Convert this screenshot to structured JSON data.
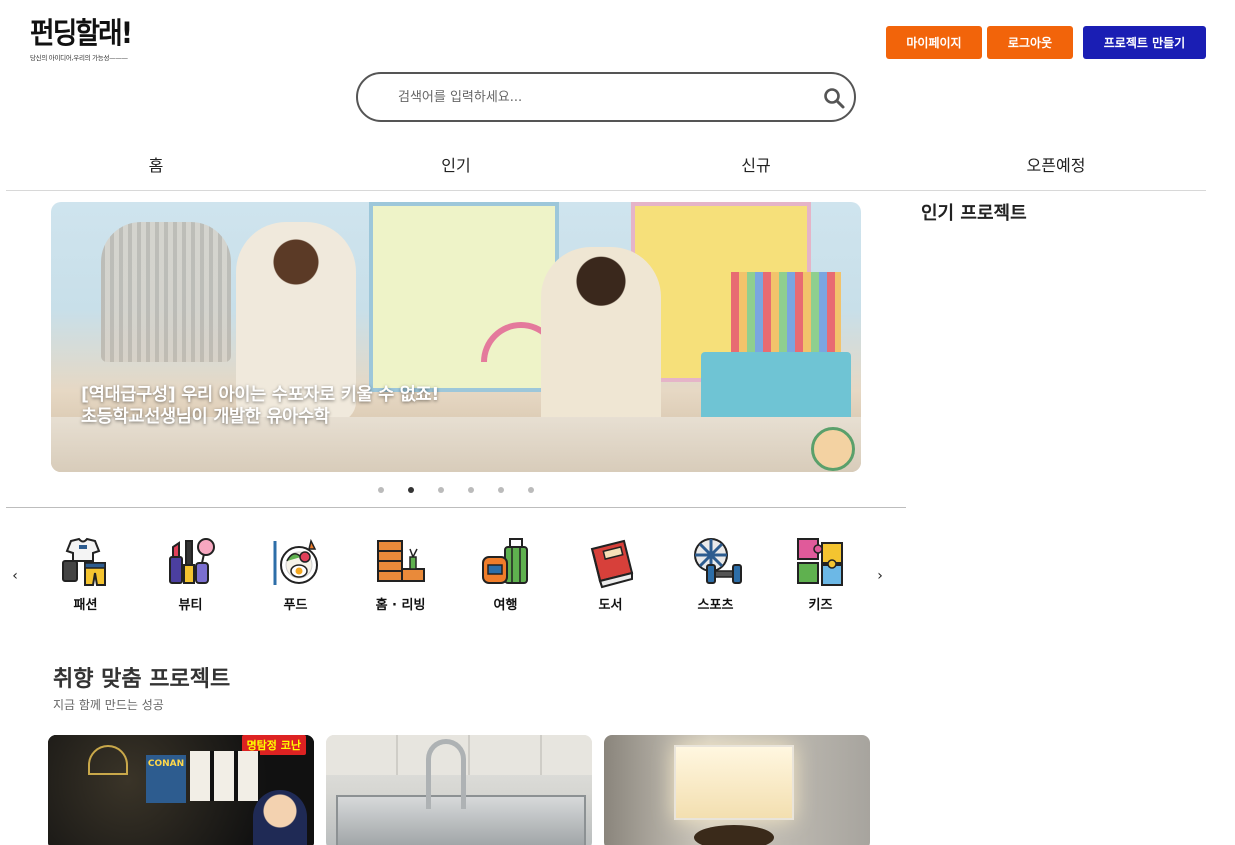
{
  "brand": {
    "logo_title": "펀딩할래!",
    "logo_subtitle": "당신의 아이디어,우리의 가능성———"
  },
  "header": {
    "mypage_label": "마이페이지",
    "logout_label": "로그아웃",
    "create_label": "프로젝트 만들기",
    "colors": {
      "orange": "#f2640a",
      "blue": "#1a1eb4"
    }
  },
  "search": {
    "placeholder": "검색어를 입력하세요..."
  },
  "nav": {
    "items": [
      {
        "label": "홈"
      },
      {
        "label": "인기"
      },
      {
        "label": "신규"
      },
      {
        "label": "오픈예정"
      }
    ]
  },
  "banner": {
    "line1": "[역대급구성] 우리 아이는 수포자로 키울 수 없죠!",
    "line2": "초등학교선생님이 개발한 유아수학",
    "slide_count": 6,
    "active_slide": 2
  },
  "sidebar": {
    "title": "인기 프로젝트"
  },
  "categories": {
    "prev_icon": "‹",
    "next_icon": "›",
    "items": [
      {
        "label": "패션",
        "icon": "clothes-icon"
      },
      {
        "label": "뷰티",
        "icon": "cosmetics-icon"
      },
      {
        "label": "푸드",
        "icon": "food-plate-icon"
      },
      {
        "label": "홈 · 리빙",
        "icon": "furniture-icon"
      },
      {
        "label": "여행",
        "icon": "luggage-icon"
      },
      {
        "label": "도서",
        "icon": "book-icon"
      },
      {
        "label": "스포츠",
        "icon": "sports-icon"
      },
      {
        "label": "키즈",
        "icon": "puzzle-icon"
      }
    ]
  },
  "recommend": {
    "title": "취향 맞춤 프로젝트",
    "subtitle": "지금 함께 만드는 성공",
    "card1_badge": "명탐정 코난",
    "card1_tag": "CONAN"
  }
}
